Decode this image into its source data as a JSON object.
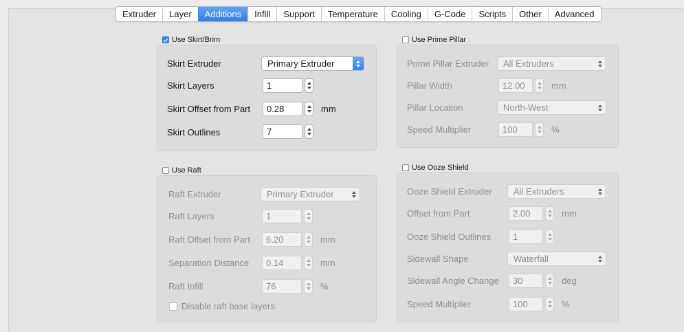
{
  "tabs": [
    "Extruder",
    "Layer",
    "Additions",
    "Infill",
    "Support",
    "Temperature",
    "Cooling",
    "G-Code",
    "Scripts",
    "Other",
    "Advanced"
  ],
  "active_tab": "Additions",
  "skirt": {
    "enable_label": "Use Skirt/Brim",
    "checked": true,
    "extruder_label": "Skirt Extruder",
    "extruder_value": "Primary Extruder",
    "layers_label": "Skirt Layers",
    "layers_value": "1",
    "offset_label": "Skirt Offset from Part",
    "offset_value": "0.28",
    "offset_unit": "mm",
    "outlines_label": "Skirt Outlines",
    "outlines_value": "7"
  },
  "raft": {
    "enable_label": "Use Raft",
    "checked": false,
    "extruder_label": "Raft Extruder",
    "extruder_value": "Primary Extruder",
    "layers_label": "Raft Layers",
    "layers_value": "1",
    "offset_label": "Raft Offset from Part",
    "offset_value": "6.20",
    "offset_unit": "mm",
    "separation_label": "Separation Distance",
    "separation_value": "0.14",
    "separation_unit": "mm",
    "infill_label": "Raft Infill",
    "infill_value": "76",
    "infill_unit": "%",
    "disable_base_label": "Disable raft base layers"
  },
  "prime_pillar": {
    "enable_label": "Use Prime Pillar",
    "checked": false,
    "extruder_label": "Prime Pillar Extruder",
    "extruder_value": "All Extruders",
    "width_label": "Pillar Width",
    "width_value": "12.00",
    "width_unit": "mm",
    "location_label": "Pillar Location",
    "location_value": "North-West",
    "speed_label": "Speed Multiplier",
    "speed_value": "100",
    "speed_unit": "%"
  },
  "ooze_shield": {
    "enable_label": "Use Ooze Shield",
    "checked": false,
    "extruder_label": "Ooze Shield Extruder",
    "extruder_value": "All Extruders",
    "offset_label": "Offset from Part",
    "offset_value": "2.00",
    "offset_unit": "mm",
    "outlines_label": "Ooze Shield Outlines",
    "outlines_value": "1",
    "sidewall_label": "Sidewall Shape",
    "sidewall_value": "Waterfall",
    "angle_label": "Sidewall Angle Change",
    "angle_value": "30",
    "angle_unit": "deg",
    "speed_label": "Speed Multiplier",
    "speed_value": "100",
    "speed_unit": "%"
  }
}
